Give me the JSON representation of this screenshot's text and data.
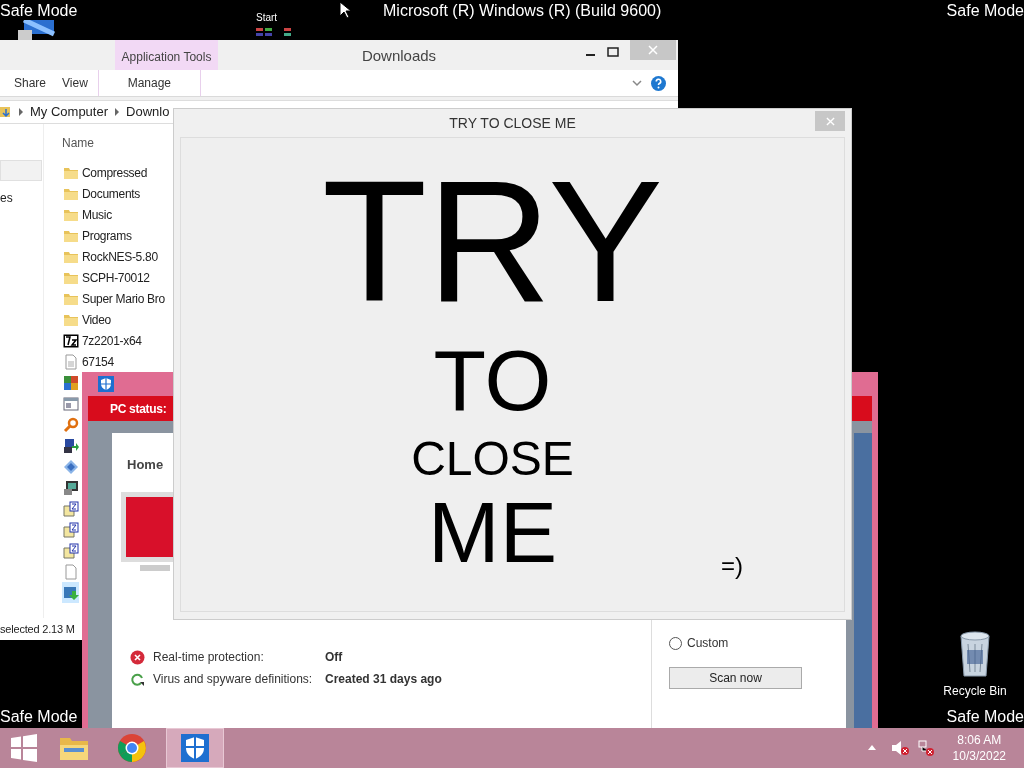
{
  "desktop": {
    "corner_labels": [
      "Safe Mode",
      "Safe Mode",
      "Safe Mode",
      "Safe Mode"
    ],
    "build_text": "Microsoft (R) Windows (R) (Build 9600)",
    "start_label": "Start",
    "icons": [
      {
        "label": "Recycle Bin"
      }
    ]
  },
  "explorer": {
    "title": "Downloads",
    "context_tab": "Application Tools",
    "ribbon_tabs": [
      {
        "label": "Share",
        "selected": false
      },
      {
        "label": "View",
        "selected": false
      },
      {
        "label": "Manage",
        "selected": false
      }
    ],
    "breadcrumb": [
      "My Computer",
      "Downlo"
    ],
    "nav_fragment": "es",
    "column": "Name",
    "files": [
      {
        "name": "Compressed",
        "kind": "folder",
        "selected": false
      },
      {
        "name": "Documents",
        "kind": "folder",
        "selected": false
      },
      {
        "name": "Music",
        "kind": "folder",
        "selected": false
      },
      {
        "name": "Programs",
        "kind": "folder",
        "selected": false
      },
      {
        "name": "RockNES-5.80",
        "kind": "folder",
        "selected": false
      },
      {
        "name": "SCPH-70012",
        "kind": "folder",
        "selected": false
      },
      {
        "name": "Super Mario Bro",
        "kind": "folder",
        "selected": false
      },
      {
        "name": "Video",
        "kind": "folder",
        "selected": false
      },
      {
        "name": "7z2201-x64",
        "kind": "sevenzip",
        "selected": false
      },
      {
        "name": "67154",
        "kind": "text",
        "selected": false
      },
      {
        "kind": "tiles",
        "selected": false
      },
      {
        "kind": "window",
        "selected": false
      },
      {
        "kind": "key",
        "selected": false
      },
      {
        "kind": "setup",
        "selected": false
      },
      {
        "kind": "diamond",
        "selected": false
      },
      {
        "kind": "terminal",
        "selected": false
      },
      {
        "kind": "zip",
        "selected": false
      },
      {
        "kind": "zip",
        "selected": false
      },
      {
        "kind": "zip",
        "selected": false
      },
      {
        "kind": "blank",
        "selected": false
      },
      {
        "kind": "installer",
        "selected": true
      }
    ],
    "status": "selected 2.13 M"
  },
  "defender": {
    "status_heading": "PC status:",
    "tab": "Home",
    "status_rows": [
      {
        "label": "Real-time protection:",
        "value": "Off",
        "kind": "error"
      },
      {
        "label": "Virus and spyware definitions:",
        "value": "Created 31 days ago",
        "kind": "refresh"
      }
    ],
    "scan_options": [
      {
        "label": "Custom",
        "selected": false
      }
    ],
    "scan_button": "Scan now"
  },
  "dialog": {
    "title": "TRY TO CLOSE ME",
    "lines": [
      "TRY",
      "TO",
      "CLOSE",
      "ME"
    ],
    "smiley": "=)"
  },
  "taskbar": {
    "apps": [
      {
        "kind": "explorer",
        "active": false
      },
      {
        "kind": "chrome",
        "active": false
      },
      {
        "kind": "defender",
        "active": true
      }
    ],
    "time": "8:06 AM",
    "date": "10/3/2022"
  }
}
